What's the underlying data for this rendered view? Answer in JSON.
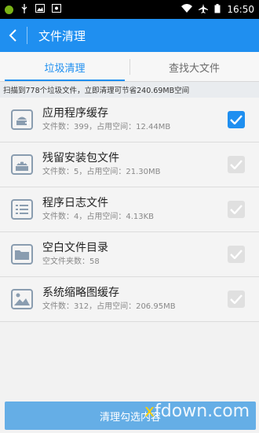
{
  "statusbar": {
    "time": "16:50"
  },
  "header": {
    "title": "文件清理"
  },
  "tabs": [
    {
      "label": "垃圾清理",
      "active": true
    },
    {
      "label": "查找大文件",
      "active": false
    }
  ],
  "summary": "扫描到778个垃圾文件，立即清理可节省240.69MB空间",
  "items": [
    {
      "name": "应用程序缓存",
      "detail": "文件数：399，占用空间：12.44MB",
      "icon": "app-cache-icon",
      "checked": true
    },
    {
      "name": "残留安装包文件",
      "detail": "文件数：5，占用空间：21.30MB",
      "icon": "apk-residue-icon",
      "checked": false
    },
    {
      "name": "程序日志文件",
      "detail": "文件数：4，占用空间：4.13KB",
      "icon": "log-file-icon",
      "checked": false
    },
    {
      "name": "空白文件目录",
      "detail": "空文件夹数：58",
      "icon": "empty-folder-icon",
      "checked": false
    },
    {
      "name": "系统缩略图缓存",
      "detail": "文件数：312，占用空间：206.95MB",
      "icon": "thumbnail-icon",
      "checked": false
    }
  ],
  "footer": {
    "button_label": "清理勾选内容"
  },
  "watermark": {
    "x": "x",
    "rest": "fdown.com"
  },
  "colors": {
    "accent": "#1f8ff0",
    "button": "#65aee6"
  }
}
